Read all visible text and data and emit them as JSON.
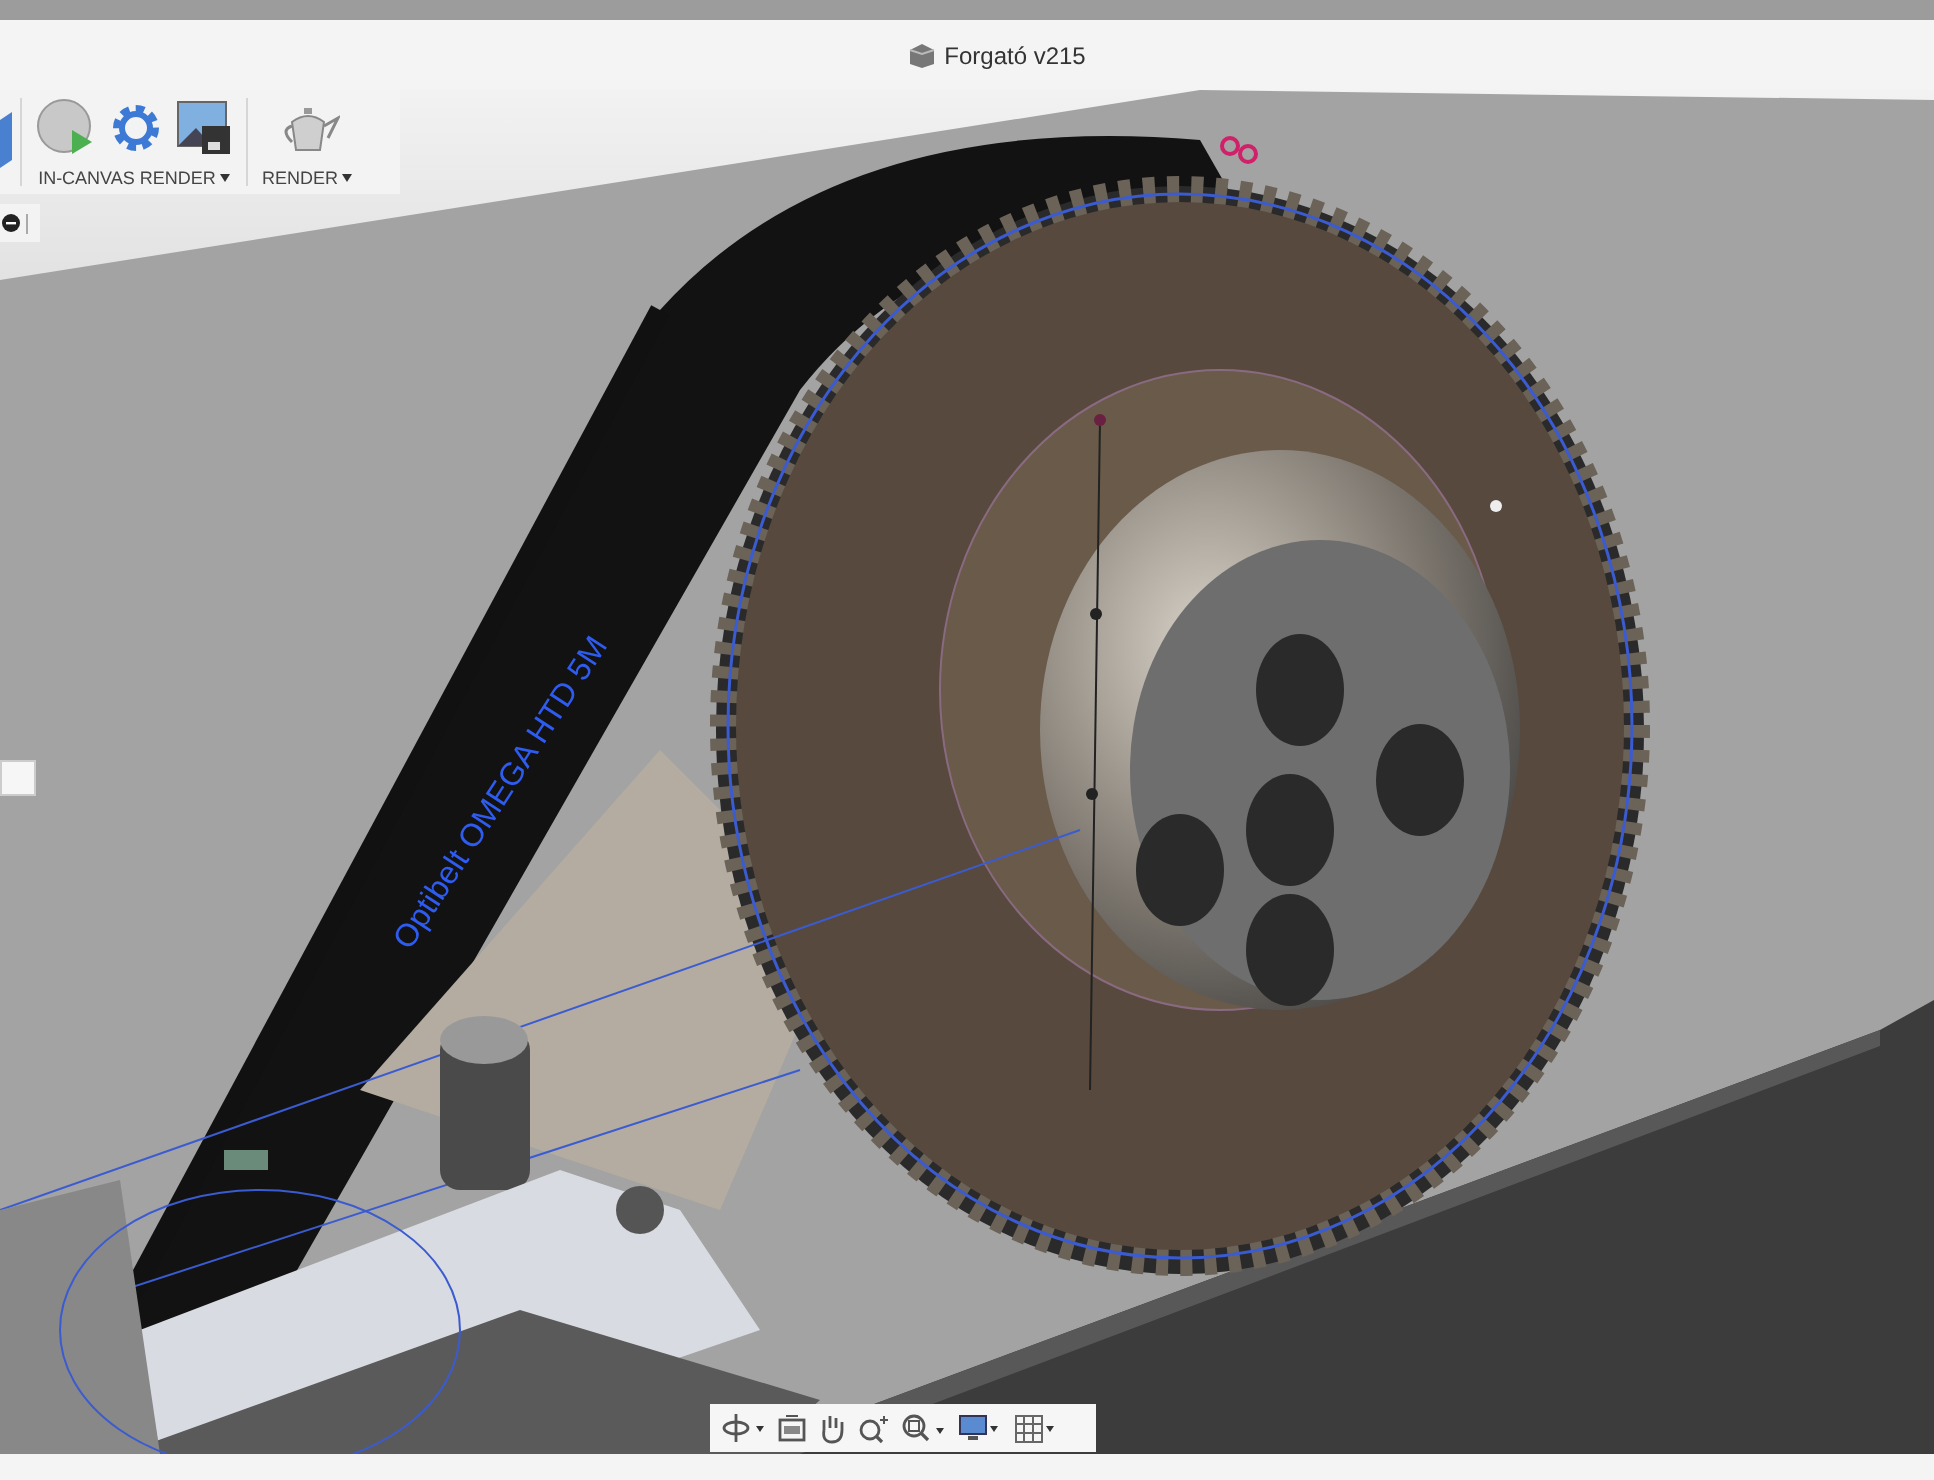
{
  "window": {
    "title": "Forgató v215"
  },
  "toolbar": {
    "groups": [
      {
        "label": "IN-CANVAS RENDER"
      },
      {
        "label": "RENDER"
      }
    ]
  },
  "viewport": {
    "model_text": "Optibelt OMEGA HTD 5M"
  }
}
